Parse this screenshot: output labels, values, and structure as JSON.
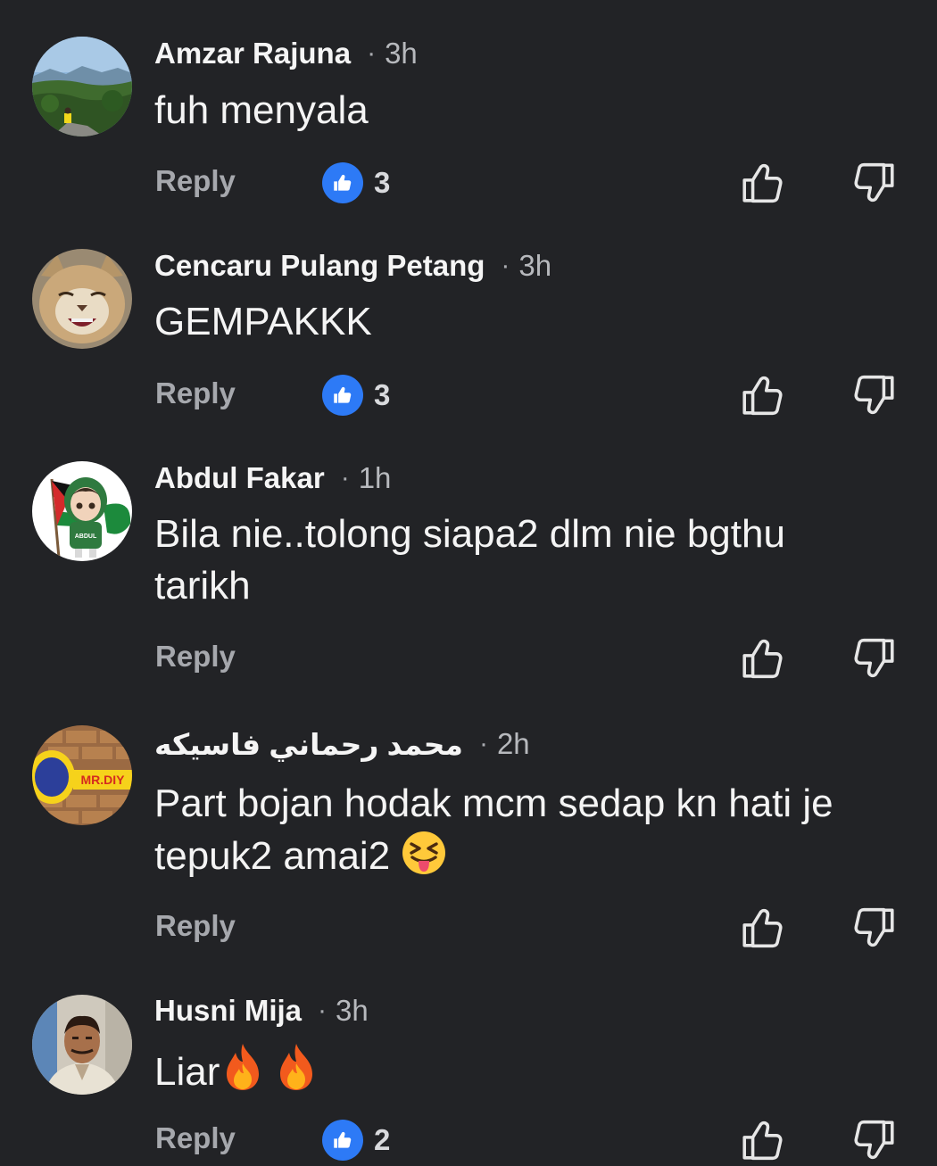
{
  "comments": [
    {
      "name": "Amzar Rajuna",
      "time": "3h",
      "text": "fuh menyala",
      "reply_label": "Reply",
      "reaction_count": "3"
    },
    {
      "name": "Cencaru Pulang Petang",
      "time": "3h",
      "text": "GEMPAKKK",
      "reply_label": "Reply",
      "reaction_count": "3"
    },
    {
      "name": "Abdul Fakar",
      "time": "1h",
      "text": "Bila nie..tolong siapa2 dlm nie bgthu tarikh",
      "reply_label": "Reply",
      "avatar_text": "ABDUL"
    },
    {
      "name": "محمد رحماني فاسيكه",
      "time": "2h",
      "text": "Part bojan hodak mcm sedap kn hati je tepuk2 amai2",
      "reply_label": "Reply",
      "avatar_text": "MR.DIY"
    },
    {
      "name": "Husni Mija",
      "time": "3h",
      "text": "Liar",
      "reply_label": "Reply",
      "reaction_count": "2"
    }
  ],
  "icons": {
    "reaction": "thumbs-up-reaction-icon",
    "like": "thumbs-up-outline-icon",
    "dislike": "thumbs-down-outline-icon",
    "emoji_squint_tongue": "squinting-face-with-tongue-emoji",
    "emoji_fire": "fire-emoji"
  },
  "colors": {
    "background": "#222326",
    "reaction_badge": "#2d7af6",
    "muted_text": "#a6a8ad"
  }
}
